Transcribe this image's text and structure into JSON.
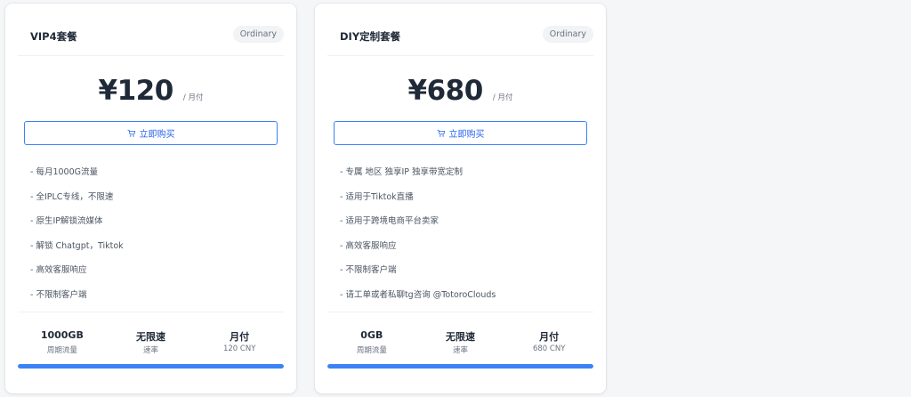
{
  "plans": [
    {
      "name": "VIP4套餐",
      "badge": "Ordinary",
      "price": "¥120",
      "period": "/ 月付",
      "buy_label": "立即购买",
      "features": [
        "- 每月1000G流量",
        "- 全IPLC专线，不限速",
        "- 原生IP解锁流媒体",
        "- 解锁 Chatgpt，Tiktok",
        "- 高效客服响应",
        "- 不限制客户端"
      ],
      "stats": [
        {
          "value": "1000GB",
          "label": "周期流量"
        },
        {
          "value": "无限速",
          "label": "速率"
        },
        {
          "value": "月付",
          "label": "120 CNY"
        }
      ],
      "progress": 1.0
    },
    {
      "name": "DIY定制套餐",
      "badge": "Ordinary",
      "price": "¥680",
      "period": "/ 月付",
      "buy_label": "立即购买",
      "features": [
        "- 专属 地区 独享IP 独享带宽定制",
        "- 适用于Tiktok直播",
        "- 适用于跨境电商平台卖家",
        "- 高效客服响应",
        "- 不限制客户端",
        "- 请工单或者私聊tg咨询 @TotoroClouds"
      ],
      "stats": [
        {
          "value": "0GB",
          "label": "周期流量"
        },
        {
          "value": "无限速",
          "label": "速率"
        },
        {
          "value": "月付",
          "label": "680 CNY"
        }
      ],
      "progress": 1.0
    }
  ],
  "colors": {
    "accent": "#3b82f6",
    "badge_bg": "#f2f3f5",
    "text_primary": "#1f2937",
    "text_muted": "#6b7280"
  },
  "icons": {
    "buy": "cart-icon"
  }
}
